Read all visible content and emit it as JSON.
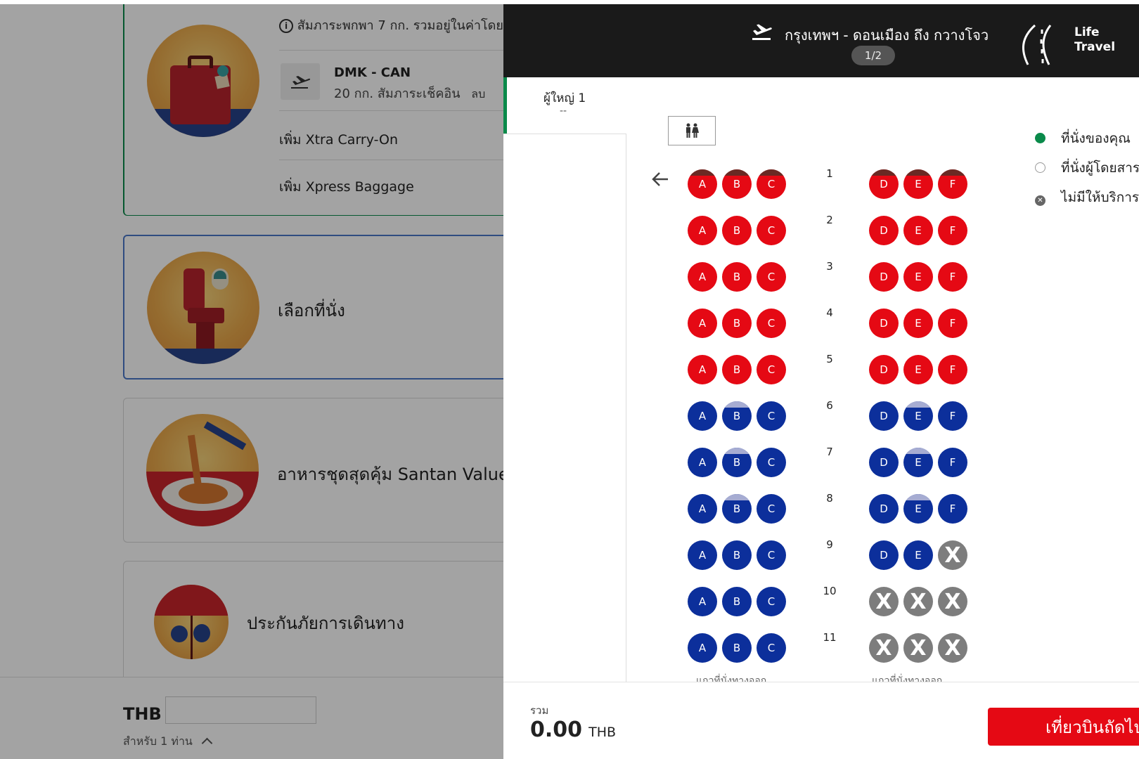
{
  "left": {
    "baggage_card": {
      "info_text": "สัมภาระพกพา 7 กก. รวมอยู่ในค่าโดย",
      "route": "DMK - CAN",
      "route_detail": "20 กก. สัมภาระเช็คอิน",
      "remove_label": "ลบ",
      "add_carry_on": "เพิ่ม Xtra Carry-On",
      "add_xpress": "เพิ่ม Xpress Baggage"
    },
    "seat_card": {
      "label": "เลือกที่นั่ง"
    },
    "meal_card": {
      "label": "อาหารชุดสุดคุ้ม Santan Value"
    },
    "insurance_card": {
      "label": "ประกันภัยการเดินทาง"
    },
    "total_bar": {
      "currency": "THB",
      "for_text": "สำหรับ 1 ท่าน"
    }
  },
  "header": {
    "route": "กรุงเทพฯ - ดอนเมือง ถึง กวางโจว",
    "flight_counter": "1/2",
    "brand_line1": "Life",
    "brand_line2": "Travel"
  },
  "passenger_tab": {
    "label": "ผู้ใหญ่ 1",
    "seat": "--"
  },
  "legend": {
    "your_seat": "ที่นั่งของคุณ",
    "other_seat": "ที่นั่งผู้โดยสาร",
    "unavailable": "ไม่มีให้บริการ"
  },
  "seat_map": {
    "rows": [
      {
        "num": "1",
        "seats": [
          {
            "l": "A",
            "s": "red",
            "c": 1
          },
          {
            "l": "B",
            "s": "red",
            "c": 1
          },
          {
            "l": "C",
            "s": "red",
            "c": 1
          },
          {
            "l": "D",
            "s": "red",
            "c": 1
          },
          {
            "l": "E",
            "s": "red",
            "c": 1
          },
          {
            "l": "F",
            "s": "red",
            "c": 1
          }
        ]
      },
      {
        "num": "2",
        "seats": [
          {
            "l": "A",
            "s": "red"
          },
          {
            "l": "B",
            "s": "red"
          },
          {
            "l": "C",
            "s": "red"
          },
          {
            "l": "D",
            "s": "red"
          },
          {
            "l": "E",
            "s": "red"
          },
          {
            "l": "F",
            "s": "red"
          }
        ]
      },
      {
        "num": "3",
        "seats": [
          {
            "l": "A",
            "s": "red"
          },
          {
            "l": "B",
            "s": "red"
          },
          {
            "l": "C",
            "s": "red"
          },
          {
            "l": "D",
            "s": "red"
          },
          {
            "l": "E",
            "s": "red"
          },
          {
            "l": "F",
            "s": "red"
          }
        ]
      },
      {
        "num": "4",
        "seats": [
          {
            "l": "A",
            "s": "red"
          },
          {
            "l": "B",
            "s": "red"
          },
          {
            "l": "C",
            "s": "red"
          },
          {
            "l": "D",
            "s": "red"
          },
          {
            "l": "E",
            "s": "red"
          },
          {
            "l": "F",
            "s": "red"
          }
        ]
      },
      {
        "num": "5",
        "seats": [
          {
            "l": "A",
            "s": "red"
          },
          {
            "l": "B",
            "s": "red"
          },
          {
            "l": "C",
            "s": "red"
          },
          {
            "l": "D",
            "s": "red"
          },
          {
            "l": "E",
            "s": "red"
          },
          {
            "l": "F",
            "s": "red"
          }
        ]
      },
      {
        "num": "6",
        "seats": [
          {
            "l": "A",
            "s": "blue"
          },
          {
            "l": "B",
            "s": "blue",
            "c": 1
          },
          {
            "l": "C",
            "s": "blue"
          },
          {
            "l": "D",
            "s": "blue"
          },
          {
            "l": "E",
            "s": "blue",
            "c": 1
          },
          {
            "l": "F",
            "s": "blue"
          }
        ]
      },
      {
        "num": "7",
        "seats": [
          {
            "l": "A",
            "s": "blue"
          },
          {
            "l": "B",
            "s": "blue",
            "c": 1
          },
          {
            "l": "C",
            "s": "blue"
          },
          {
            "l": "D",
            "s": "blue"
          },
          {
            "l": "E",
            "s": "blue",
            "c": 1
          },
          {
            "l": "F",
            "s": "blue"
          }
        ]
      },
      {
        "num": "8",
        "seats": [
          {
            "l": "A",
            "s": "blue"
          },
          {
            "l": "B",
            "s": "blue",
            "c": 1
          },
          {
            "l": "C",
            "s": "blue"
          },
          {
            "l": "D",
            "s": "blue"
          },
          {
            "l": "E",
            "s": "blue",
            "c": 1
          },
          {
            "l": "F",
            "s": "blue"
          }
        ]
      },
      {
        "num": "9",
        "seats": [
          {
            "l": "A",
            "s": "blue"
          },
          {
            "l": "B",
            "s": "blue"
          },
          {
            "l": "C",
            "s": "blue"
          },
          {
            "l": "D",
            "s": "blue"
          },
          {
            "l": "E",
            "s": "blue"
          },
          {
            "l": "X",
            "s": "na"
          }
        ]
      },
      {
        "num": "10",
        "seats": [
          {
            "l": "A",
            "s": "blue"
          },
          {
            "l": "B",
            "s": "blue"
          },
          {
            "l": "C",
            "s": "blue"
          },
          {
            "l": "X",
            "s": "na"
          },
          {
            "l": "X",
            "s": "na"
          },
          {
            "l": "X",
            "s": "na"
          }
        ]
      },
      {
        "num": "11",
        "seats": [
          {
            "l": "A",
            "s": "blue"
          },
          {
            "l": "B",
            "s": "blue"
          },
          {
            "l": "C",
            "s": "blue"
          },
          {
            "l": "X",
            "s": "na"
          },
          {
            "l": "X",
            "s": "na"
          },
          {
            "l": "X",
            "s": "na"
          }
        ]
      }
    ],
    "exit_row_label": "แถวที่นั่งทางออก"
  },
  "footer": {
    "total_label": "รวม",
    "total_amount": "0.00",
    "currency": "THB",
    "next_button": "เที่ยวบินถัดไป"
  },
  "colors": {
    "red_seat": "#e50914",
    "blue_seat": "#0c2f9b",
    "na_seat": "#7d7d7d",
    "accent_green": "#0a8a4a"
  }
}
